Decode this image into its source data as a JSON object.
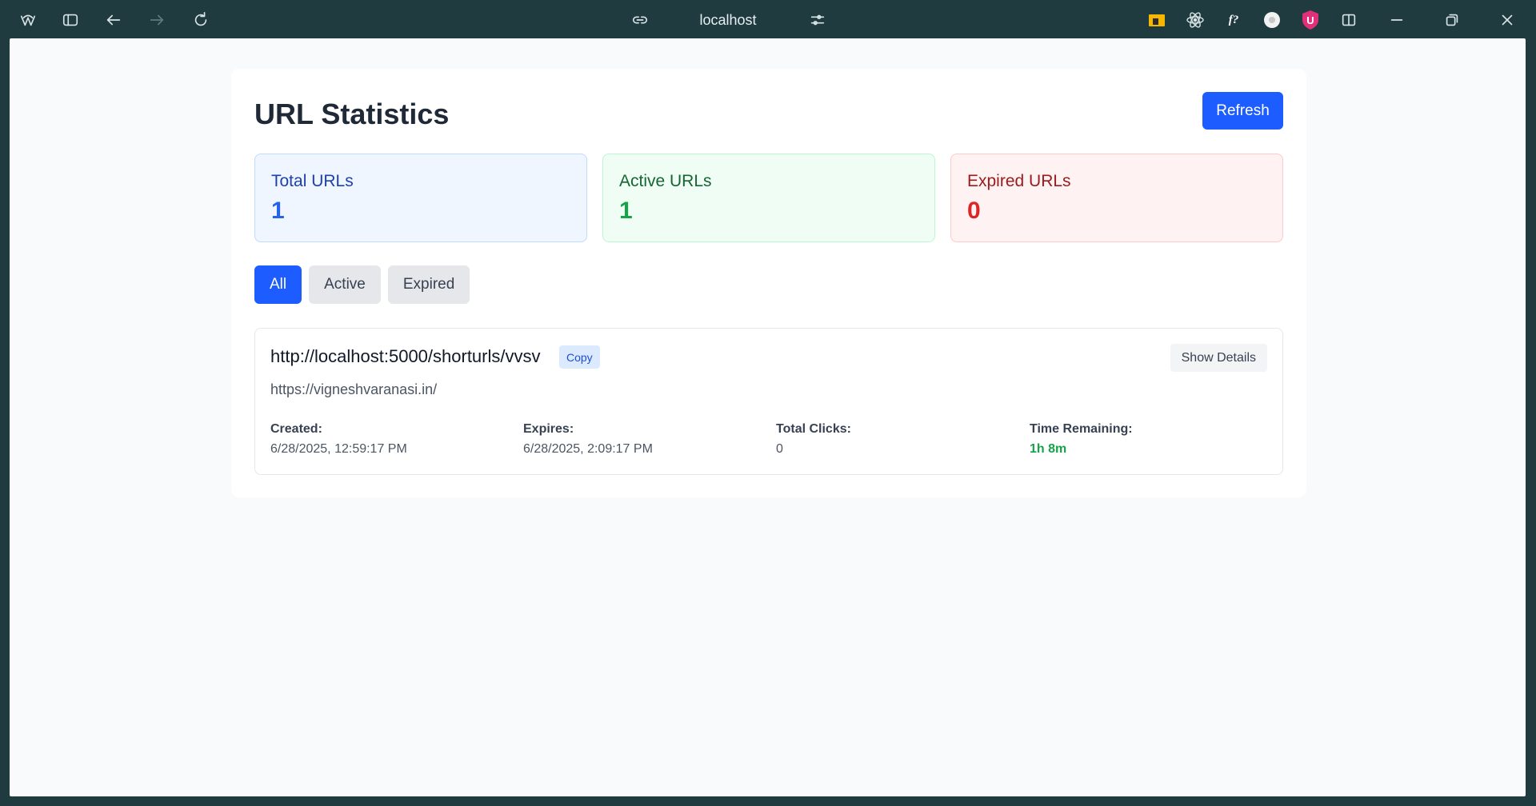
{
  "browser": {
    "address": "localhost",
    "ext_f_label": "f?",
    "ext_u_label": "U"
  },
  "page": {
    "title": "URL Statistics",
    "refresh_label": "Refresh"
  },
  "stats": {
    "total": {
      "label": "Total URLs",
      "value": "1"
    },
    "active": {
      "label": "Active URLs",
      "value": "1"
    },
    "expired": {
      "label": "Expired URLs",
      "value": "0"
    }
  },
  "filters": [
    {
      "label": "All",
      "selected": true
    },
    {
      "label": "Active",
      "selected": false
    },
    {
      "label": "Expired",
      "selected": false
    }
  ],
  "urls": [
    {
      "short_url": "http://localhost:5000/shorturls/vvsv",
      "copy_label": "Copy",
      "details_label": "Show Details",
      "long_url": "https://vigneshvaranasi.in/",
      "created_label": "Created:",
      "created": "6/28/2025, 12:59:17 PM",
      "expires_label": "Expires:",
      "expires": "6/28/2025, 2:09:17 PM",
      "clicks_label": "Total Clicks:",
      "clicks": "0",
      "remaining_label": "Time Remaining:",
      "remaining": "1h 8m"
    }
  ],
  "colors": {
    "accent": "#1d5cff",
    "chrome": "#1f3b40"
  }
}
